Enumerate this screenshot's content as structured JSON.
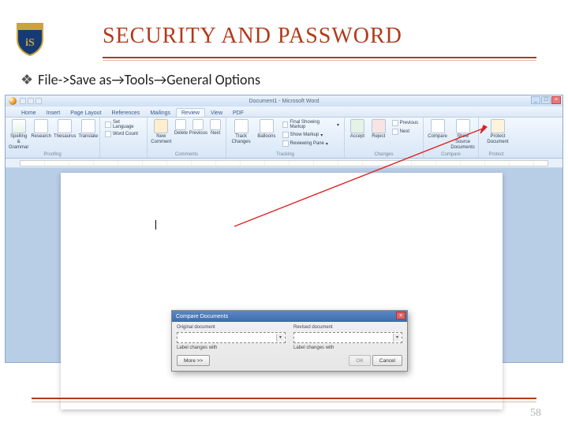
{
  "slide": {
    "title": "SECURITY AND PASSWORD",
    "bullet": "File->Save as→Tools→General Options",
    "page_number": "58"
  },
  "word": {
    "doc_title": "Document1 - Microsoft Word",
    "tabs": [
      "Home",
      "Insert",
      "Page Layout",
      "References",
      "Mailings",
      "Review",
      "View",
      "PDF"
    ],
    "active_tab": 5,
    "ribbon": {
      "proofing": {
        "name": "Proofing",
        "buttons": [
          "Spelling & Grammar",
          "Research",
          "Thesaurus",
          "Translate"
        ]
      },
      "language": {
        "name": "",
        "set_language": "Set Language",
        "word_count": "Word Count"
      },
      "comments": {
        "name": "Comments",
        "buttons": [
          "New Comment",
          "Delete",
          "Previous",
          "Next"
        ]
      },
      "tracking": {
        "name": "Tracking",
        "track_changes": "Track Changes",
        "balloons": "Balloons",
        "final_showing": "Final Showing Markup",
        "show_markup": "Show Markup",
        "reviewing_pane": "Reviewing Pane"
      },
      "changes": {
        "name": "Changes",
        "accept": "Accept",
        "reject": "Reject",
        "previous": "Previous",
        "next": "Next"
      },
      "compare": {
        "name": "Compare",
        "compare": "Compare",
        "show_source": "Show Source Documents"
      },
      "protect": {
        "name": "Protect",
        "protect": "Protect Document"
      }
    }
  },
  "dialog": {
    "title": "Compare Documents",
    "original_label": "Original document",
    "revised_label": "Revised document",
    "label_changes": "Label changes with",
    "more": "More >>",
    "ok": "OK",
    "cancel": "Cancel"
  }
}
